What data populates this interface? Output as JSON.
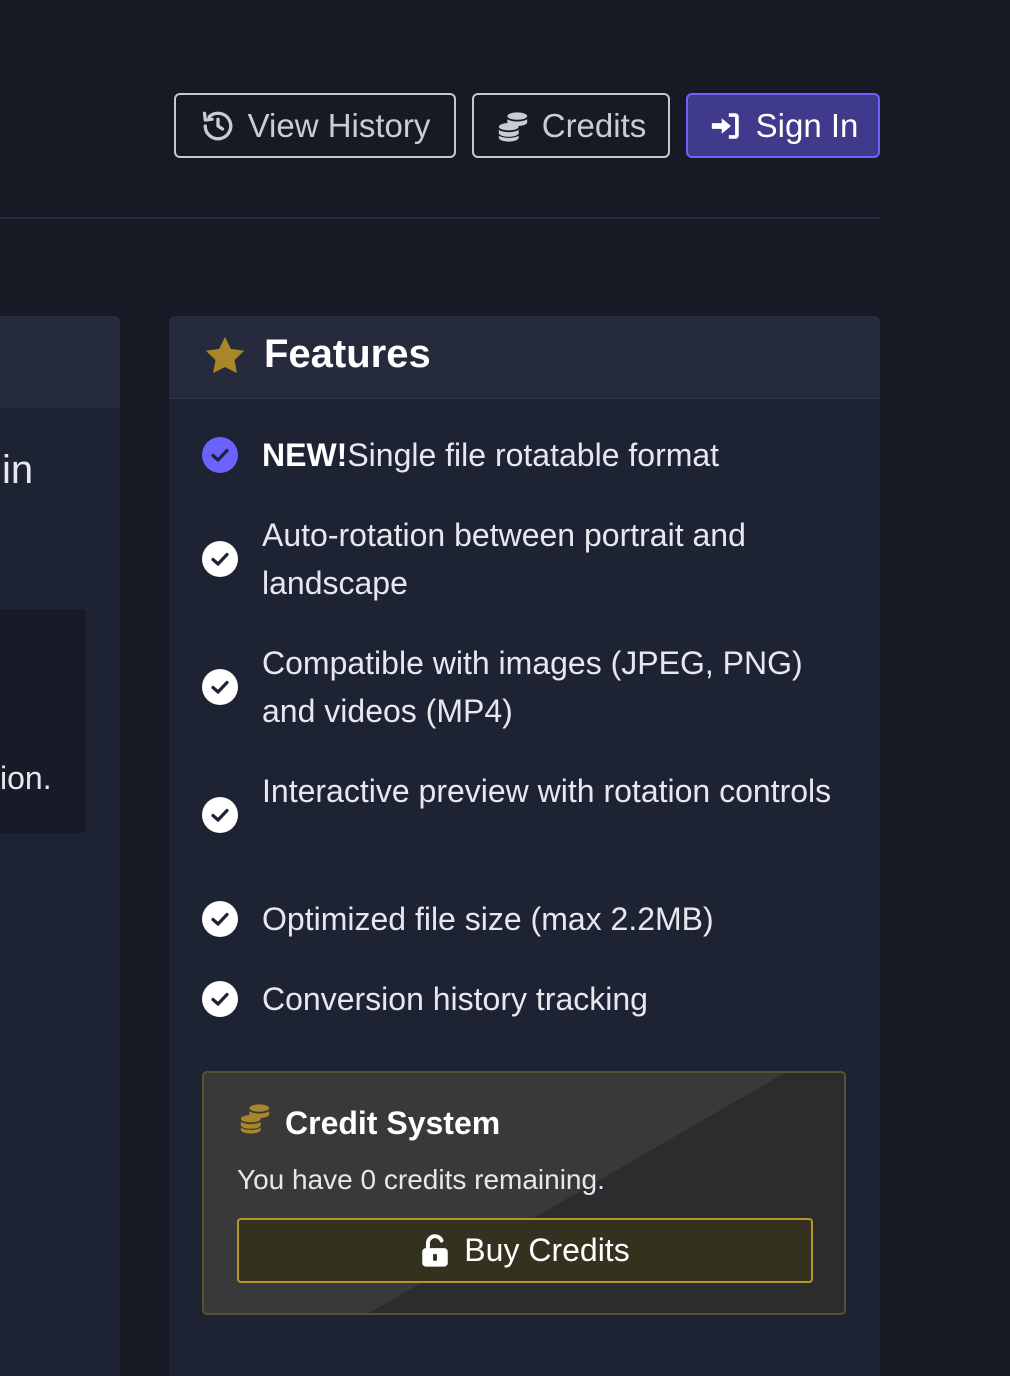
{
  "nav": {
    "history_label": "View History",
    "credits_label": "Credits",
    "signin_label": "Sign In"
  },
  "left_panel": {
    "fragment_1": "in",
    "fragment_2": "ion."
  },
  "features": {
    "title": "Features",
    "items": [
      {
        "badge": "NEW!",
        "text": "Single file rotatable format",
        "highlight": true
      },
      {
        "text": "Auto-rotation between portrait and landscape"
      },
      {
        "text": "Compatible with images (JPEG, PNG) and videos (MP4)"
      },
      {
        "text": "Interactive preview with rotation controls"
      },
      {
        "text": "Optimized file size (max 2.2MB)"
      },
      {
        "text": "Conversion history tracking"
      }
    ]
  },
  "credit_system": {
    "title": "Credit System",
    "text": "You have 0 credits remaining.",
    "buy_label": "Buy Credits"
  },
  "colors": {
    "background": "#161a25",
    "card": "#1e2334",
    "card_header": "#252b3d",
    "accent_purple": "#6c63ff",
    "accent_gold": "#b6962c"
  },
  "icons": [
    "history-icon",
    "coins-icon",
    "sign-in-icon",
    "star-icon",
    "check-circle-icon",
    "lock-open-icon"
  ]
}
